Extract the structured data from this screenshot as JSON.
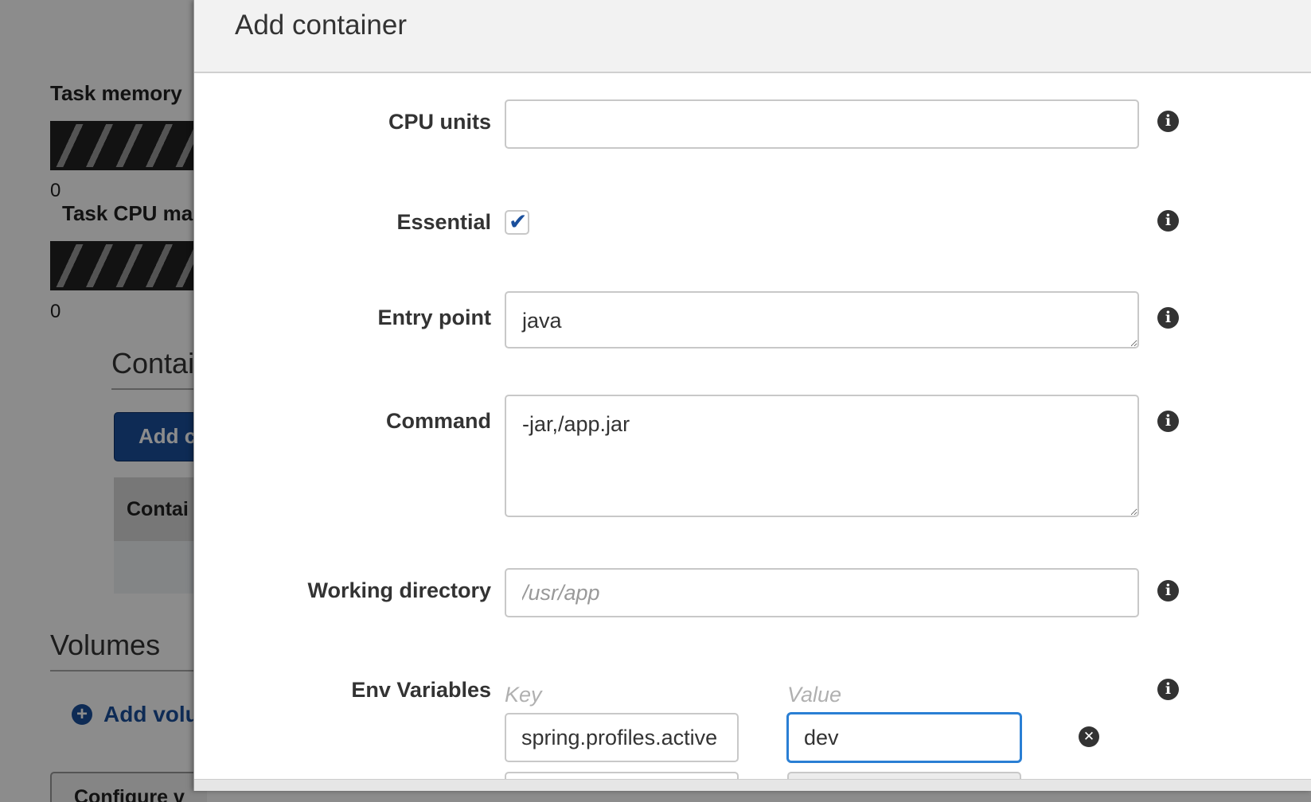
{
  "background": {
    "task_memory_label": "Task memory",
    "task_memory_value": "0",
    "task_cpu_label": "Task CPU ma",
    "task_cpu_value": "0",
    "containers_title": "Contai",
    "add_container_button": "Add c",
    "table_header": "Contai",
    "volumes_title": "Volumes",
    "add_volume_link": "Add volu",
    "configure_button": "Configure v"
  },
  "modal": {
    "title": "Add container",
    "fields": {
      "cpu_units": {
        "label": "CPU units",
        "value": ""
      },
      "essential": {
        "label": "Essential",
        "checked": true
      },
      "entry_point": {
        "label": "Entry point",
        "value": "java"
      },
      "command": {
        "label": "Command",
        "value": "-jar,/app.jar"
      },
      "working_directory": {
        "label": "Working directory",
        "value": "",
        "placeholder": "/usr/app"
      }
    },
    "env_variables": {
      "label": "Env Variables",
      "key_header": "Key",
      "value_header": "Value",
      "rows": [
        {
          "key": "spring.profiles.active",
          "value": "dev"
        }
      ]
    }
  },
  "icons": {
    "info": "info-icon",
    "remove": "remove-icon",
    "check": "checkmark-icon",
    "plus": "plus-circle-icon"
  },
  "colors": {
    "primary_blue": "#1a4f9c",
    "focus_blue": "#2a7fd4",
    "label_text": "#333333",
    "header_bg": "#f2f2f2"
  }
}
